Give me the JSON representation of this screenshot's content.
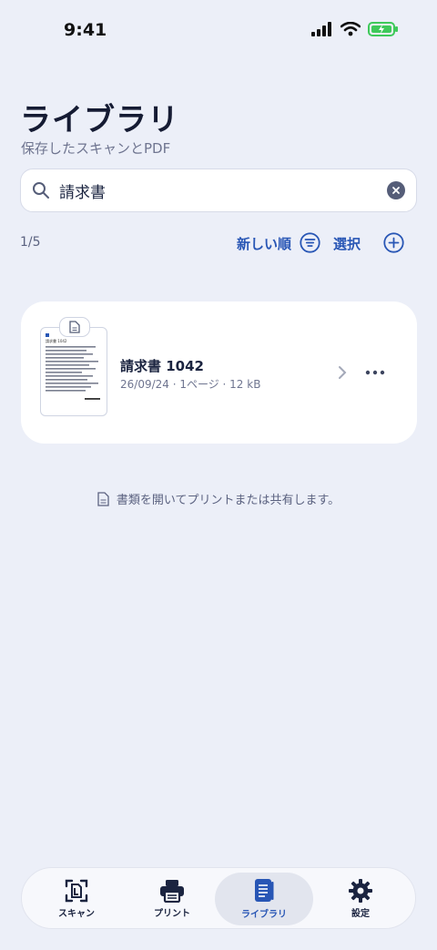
{
  "status": {
    "time": "9:41"
  },
  "header": {
    "title": "ライブラリ",
    "subtitle": "保存したスキャンとPDF"
  },
  "search": {
    "value": "請求書"
  },
  "toolbar": {
    "count": "1/5",
    "sort_label": "新しい順",
    "select_label": "選択"
  },
  "documents": [
    {
      "name": "請求書 1042",
      "meta": "26/09/24 · 1ページ · 12 kB",
      "thumb_header": "請求書 1042"
    }
  ],
  "hint": "書類を開いてプリントまたは共有します。",
  "tabs": [
    {
      "label": "スキャン",
      "icon": "scan-icon"
    },
    {
      "label": "プリント",
      "icon": "printer-icon"
    },
    {
      "label": "ライブラリ",
      "icon": "library-icon",
      "active": true
    },
    {
      "label": "設定",
      "icon": "gear-icon"
    }
  ],
  "colors": {
    "accent": "#2856b5",
    "background": "#eceff8",
    "battery": "#3ec95a"
  }
}
